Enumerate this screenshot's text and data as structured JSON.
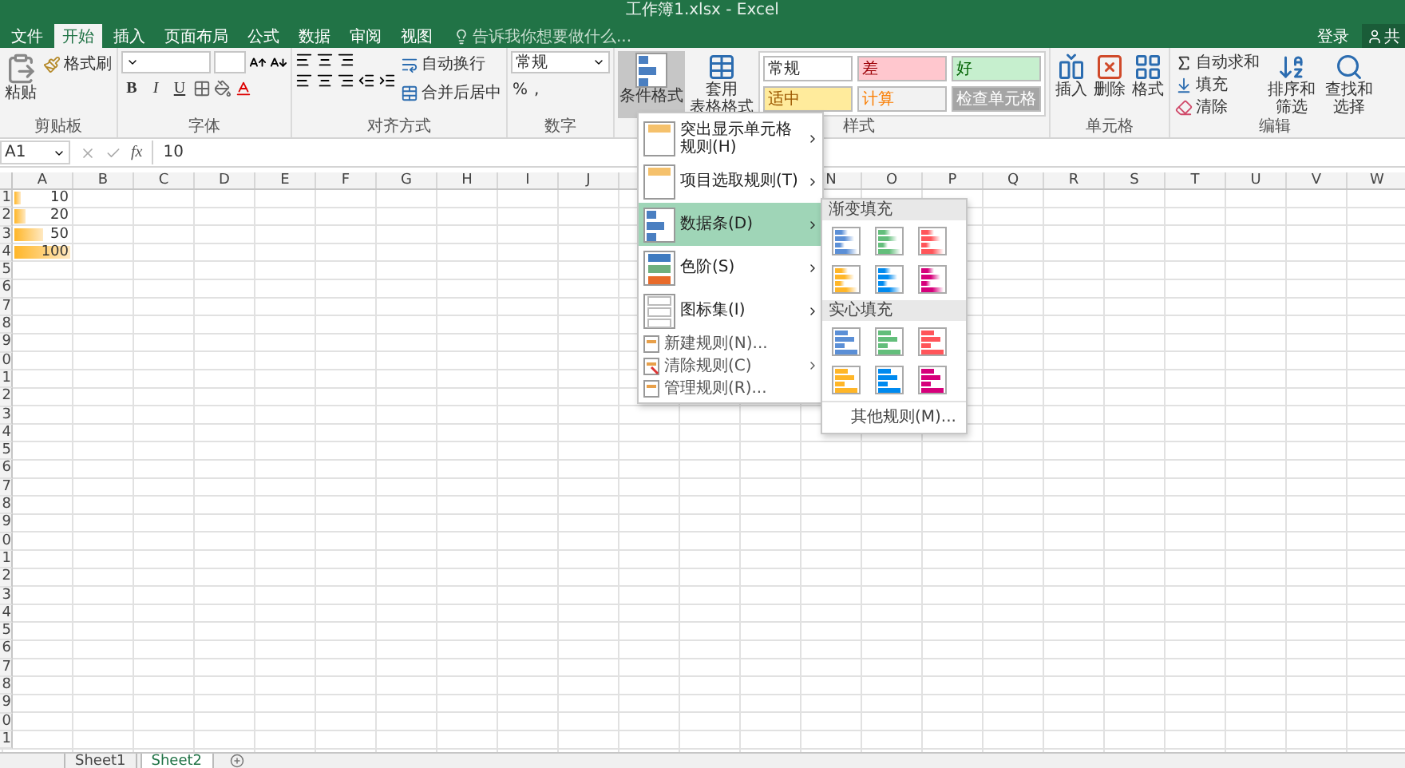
{
  "window": {
    "title": "工作簿1.xlsx - Excel"
  },
  "ribbon_tabs": [
    {
      "label": "文件",
      "selected": false
    },
    {
      "label": "开始",
      "selected": true
    },
    {
      "label": "插入",
      "selected": false
    },
    {
      "label": "页面布局",
      "selected": false
    },
    {
      "label": "公式",
      "selected": false
    },
    {
      "label": "数据",
      "selected": false
    },
    {
      "label": "审阅",
      "selected": false
    },
    {
      "label": "视图",
      "selected": false
    }
  ],
  "tell_me": {
    "placeholder": "告诉我你想要做什么..."
  },
  "account": {
    "sign_in": "登录",
    "share": "共"
  },
  "clipboard": {
    "label": "剪贴板",
    "paste": "粘贴",
    "format_painter": "格式刷"
  },
  "font": {
    "label": "字体",
    "bold": "B",
    "italic": "I",
    "underline": "U"
  },
  "alignment": {
    "label": "对齐方式",
    "wrap": "自动换行",
    "merge": "合并后居中"
  },
  "number": {
    "label": "数字",
    "format": "常规",
    "percent": "%",
    "comma": ","
  },
  "styles": {
    "label": "样式",
    "conditional": {
      "label": "条件格式",
      "pressed": true
    },
    "table_format": [
      "套用",
      "表格格式"
    ],
    "cell_styles": [
      {
        "label": "常规",
        "color": "#ffffff"
      },
      {
        "label": "差",
        "color": "#ffc7ce"
      },
      {
        "label": "好",
        "color": "#c6efce"
      },
      {
        "label": "适中",
        "color": "#ffeb9c"
      },
      {
        "label": "计算",
        "color": "#f2f2f2"
      },
      {
        "label": "检查单元格",
        "color": "#a5a5a5"
      }
    ]
  },
  "cells": {
    "label": "单元格",
    "insert": "插入",
    "delete": "删除",
    "format": "格式"
  },
  "editing": {
    "label": "编辑",
    "autosum": "自动求和",
    "fill": "填充",
    "clear": "清除",
    "sort": "排序和筛选",
    "find": "查找和选择"
  },
  "formula_bar": {
    "name_box": "A1",
    "fx": "fx",
    "value": "10"
  },
  "columns_left": [
    "A",
    "B",
    "C",
    "D",
    "E",
    "F",
    "G",
    "H",
    "I",
    "J"
  ],
  "columns_right": [
    "N",
    "O",
    "P",
    "Q",
    "R",
    "S",
    "T",
    "U",
    "V",
    "W"
  ],
  "rows": [
    {
      "label": "1",
      "a": "10",
      "level": 0.1
    },
    {
      "label": "2",
      "a": "20",
      "level": 0.2
    },
    {
      "label": "3",
      "a": "50",
      "level": 0.5
    },
    {
      "label": "4",
      "a": "100",
      "level": 1
    },
    {
      "label": "5"
    },
    {
      "label": "6"
    },
    {
      "label": "7"
    },
    {
      "label": "8"
    },
    {
      "label": "9"
    },
    {
      "label": "0"
    },
    {
      "label": "1"
    },
    {
      "label": "2"
    },
    {
      "label": "3"
    },
    {
      "label": "4"
    },
    {
      "label": "5"
    },
    {
      "label": "6"
    },
    {
      "label": "7"
    },
    {
      "label": "8"
    },
    {
      "label": "9"
    },
    {
      "label": "0"
    },
    {
      "label": "1"
    },
    {
      "label": "2"
    },
    {
      "label": "3"
    },
    {
      "label": "4"
    },
    {
      "label": "5"
    },
    {
      "label": "6"
    },
    {
      "label": "7"
    },
    {
      "label": "8"
    },
    {
      "label": "9"
    },
    {
      "label": "0"
    },
    {
      "label": "1"
    }
  ],
  "cf_menu": [
    {
      "kind": "large",
      "label": "突出显示单元格规则(H)",
      "submenu": true,
      "selected": false
    },
    {
      "kind": "large",
      "label": "项目选取规则(T)",
      "submenu": true,
      "selected": false
    },
    {
      "kind": "large",
      "label": "数据条(D)",
      "submenu": true,
      "selected": true
    },
    {
      "kind": "large",
      "label": "色阶(S)",
      "submenu": true,
      "selected": false
    },
    {
      "kind": "large",
      "label": "图标集(I)",
      "submenu": true,
      "selected": false
    },
    {
      "kind": "small",
      "label": "新建规则(N)...",
      "submenu": false,
      "selected": false
    },
    {
      "kind": "small",
      "label": "清除规则(C)",
      "submenu": true,
      "selected": false
    },
    {
      "kind": "small",
      "label": "管理规则(R)...",
      "submenu": false,
      "selected": false
    }
  ],
  "data_bar_menu": {
    "sections": [
      {
        "title": "渐变填充",
        "kind": "gradient",
        "swatches": [
          {
            "color": "#5b8fd6"
          },
          {
            "color": "#63be7b"
          },
          {
            "color": "#ff555a"
          },
          {
            "color": "#ffb628"
          },
          {
            "color": "#008aef"
          },
          {
            "color": "#d6007b"
          }
        ]
      },
      {
        "title": "实心填充",
        "kind": "solid",
        "swatches": [
          {
            "color": "#5b8fd6"
          },
          {
            "color": "#63be7b"
          },
          {
            "color": "#ff555a"
          },
          {
            "color": "#ffb628"
          },
          {
            "color": "#008aef"
          },
          {
            "color": "#d6007b"
          }
        ]
      }
    ],
    "more": "其他规则(M)..."
  },
  "sheets": [
    {
      "label": "Sheet1",
      "selected": false
    },
    {
      "label": "Sheet2",
      "selected": true
    }
  ]
}
